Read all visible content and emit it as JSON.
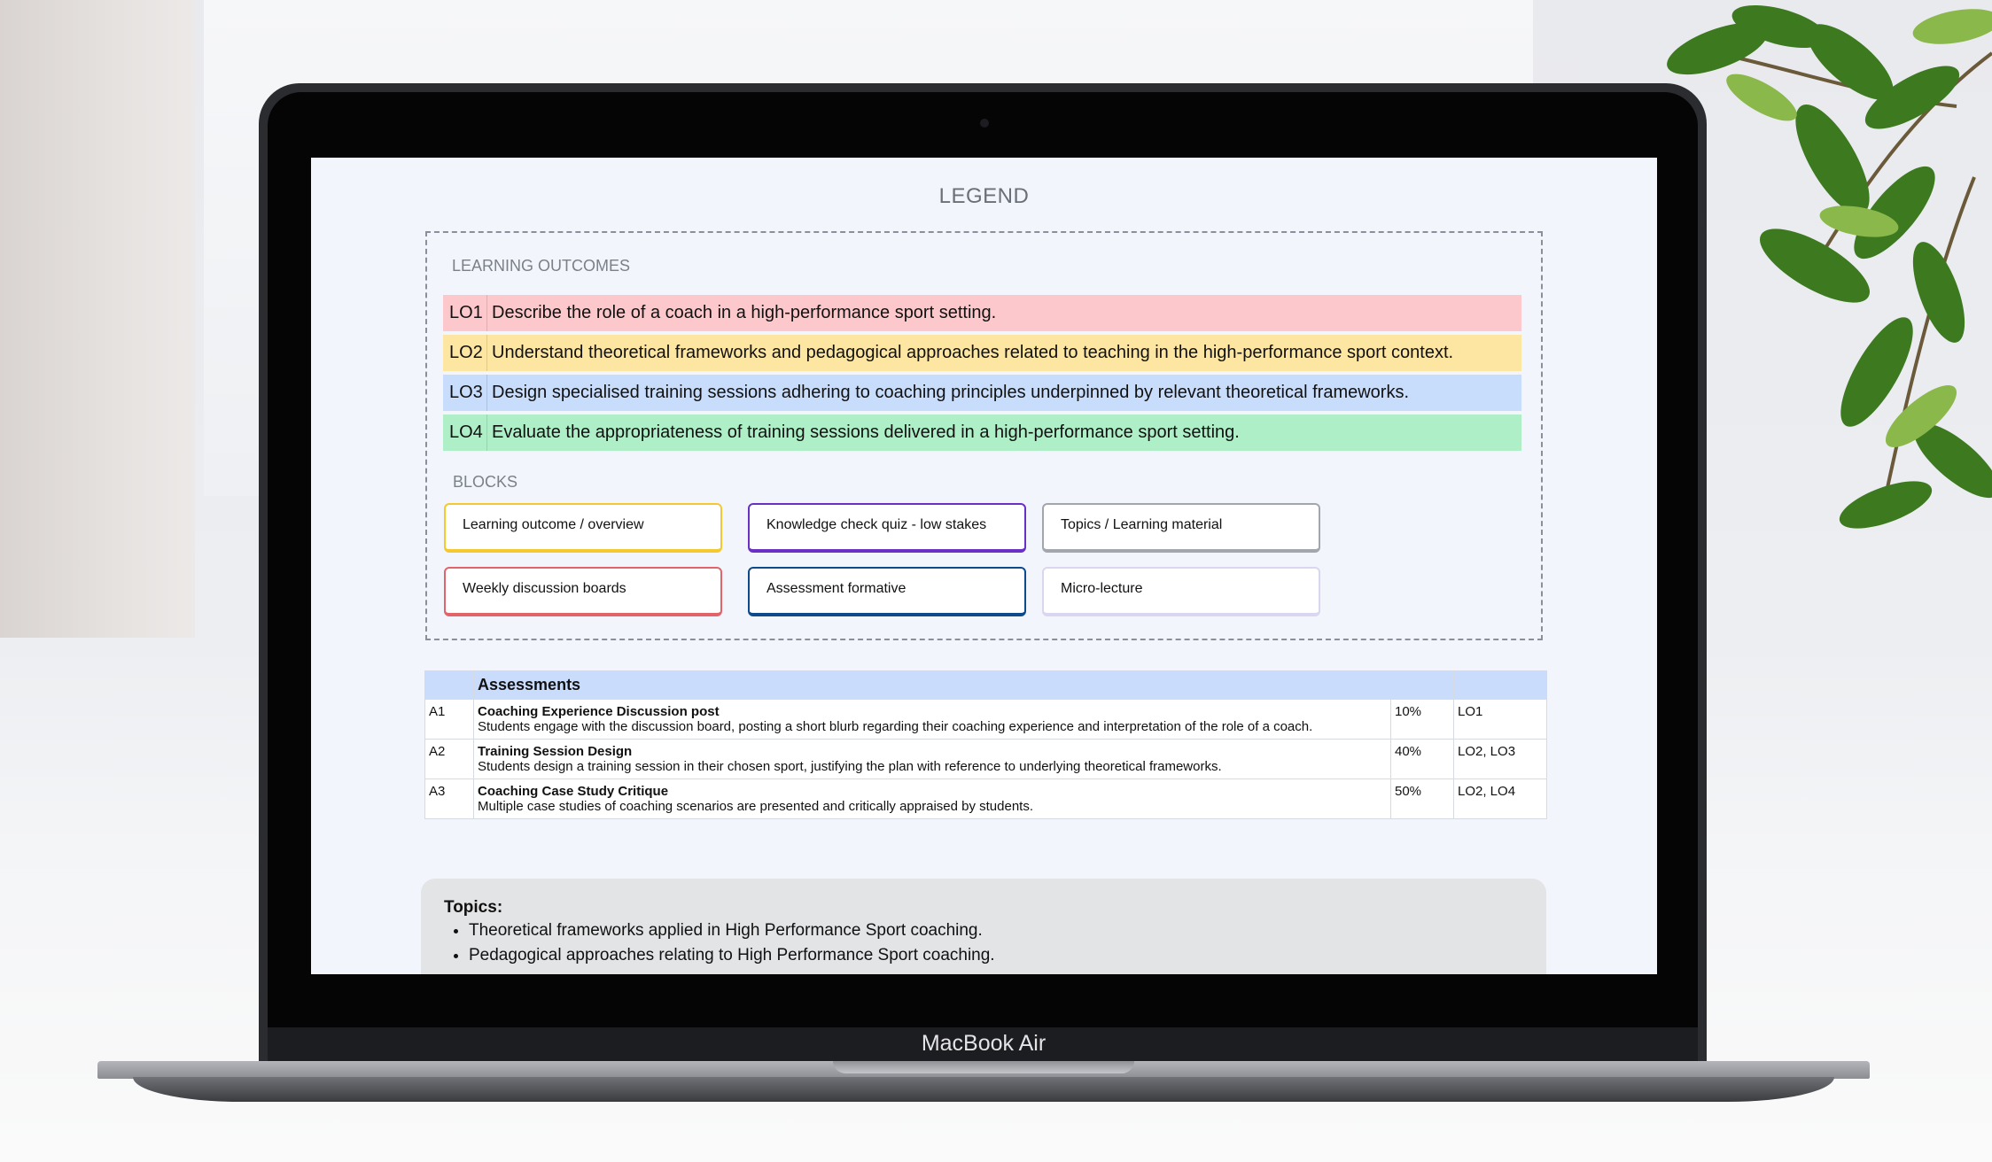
{
  "device": {
    "brand_label": "MacBook Air"
  },
  "legend": {
    "title": "LEGEND",
    "learning_outcomes_label": "LEARNING OUTCOMES",
    "outcomes": [
      {
        "code": "LO1",
        "text": "Describe the role of a coach in a high-performance sport setting.",
        "color": "#fdc8cb"
      },
      {
        "code": "LO2",
        "text": "Understand theoretical frameworks and pedagogical approaches related to teaching in the high-performance sport context.",
        "color": "#fde6a2"
      },
      {
        "code": "LO3",
        "text": "Design specialised training sessions adhering to coaching principles underpinned by relevant theoretical frameworks.",
        "color": "#c8dcfc"
      },
      {
        "code": "LO4",
        "text": "Evaluate the appropriateness of training sessions delivered in a high-performance sport setting.",
        "color": "#aeefc8"
      }
    ],
    "blocks_label": "BLOCKS",
    "blocks": [
      {
        "label": "Learning outcome / overview",
        "color": "#f4c930"
      },
      {
        "label": "Knowledge check quiz - low stakes",
        "color": "#6a2fc4"
      },
      {
        "label": "Topics / Learning material",
        "color": "#a3a6ad"
      },
      {
        "label": "Weekly discussion boards",
        "color": "#e06469"
      },
      {
        "label": "Assessment formative",
        "color": "#0d4a8c"
      },
      {
        "label": "Micro-lecture",
        "color": "#d9d6ef"
      }
    ]
  },
  "assessments": {
    "header": "Assessments",
    "rows": [
      {
        "id": "A1",
        "title": "Coaching Experience Discussion post",
        "description": "Students engage with the discussion board, posting a short blurb regarding their coaching experience and interpretation of the role of a coach.",
        "weight": "10%",
        "outcomes": "LO1"
      },
      {
        "id": "A2",
        "title": "Training Session Design",
        "description": "Students design a training session in their chosen sport, justifying the plan with reference to underlying theoretical frameworks.",
        "weight": "40%",
        "outcomes": "LO2, LO3"
      },
      {
        "id": "A3",
        "title": "Coaching Case Study Critique",
        "description": "Multiple case studies of coaching scenarios are presented and critically appraised by students.",
        "weight": "50%",
        "outcomes": "LO2, LO4"
      }
    ]
  },
  "topics": {
    "title": "Topics:",
    "items": [
      "Theoretical frameworks applied in High Performance Sport coaching.",
      "Pedagogical approaches relating to High Performance Sport coaching."
    ]
  }
}
